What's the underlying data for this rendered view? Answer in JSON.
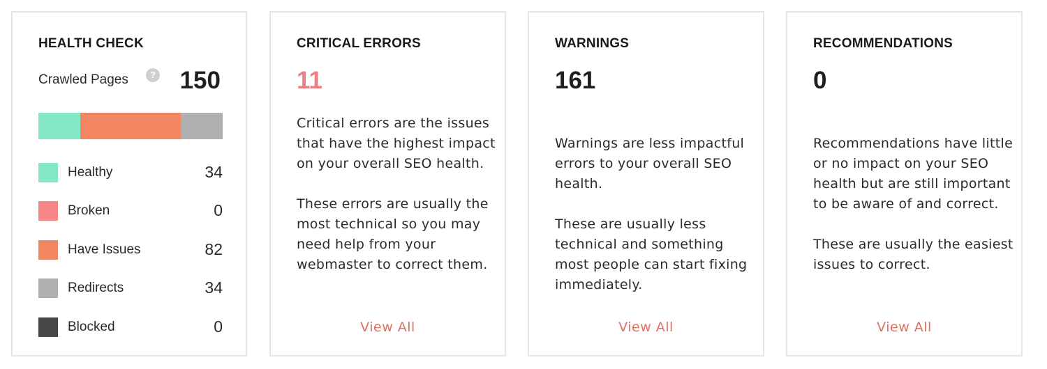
{
  "health_check": {
    "title": "HEALTH CHECK",
    "crawled_label": "Crawled Pages",
    "help_icon": "?",
    "crawled_value": "150",
    "items": [
      {
        "label": "Healthy",
        "value": "34",
        "color": "#84e8c4"
      },
      {
        "label": "Broken",
        "value": "0",
        "color": "#f78787"
      },
      {
        "label": "Have Issues",
        "value": "82",
        "color": "#f28663"
      },
      {
        "label": "Redirects",
        "value": "34",
        "color": "#b0b0b3"
      },
      {
        "label": "Blocked",
        "value": "0",
        "color": "#474747"
      }
    ],
    "bar_fractions": {
      "healthy": 0.2267,
      "broken": 0,
      "have_issues": 0.5467,
      "redirects": 0.2267,
      "blocked": 0
    }
  },
  "critical": {
    "title": "CRITICAL ERRORS",
    "value": "11",
    "para1": "Critical errors are the issues that have the highest impact on your overall SEO health.",
    "para2": "These errors are usually the most technical so you may need help from your webmaster to correct them.",
    "link": "View All"
  },
  "warnings": {
    "title": "WARNINGS",
    "value": "161",
    "para1": "Warnings are less impactful errors to your overall SEO health.",
    "para2": "These are usually less technical and something most people can start fixing immediately.",
    "link": "View All"
  },
  "recommendations": {
    "title": "RECOMMENDATIONS",
    "value": "0",
    "para1": "Recommendations have little or no impact on your SEO health but are still important to be aware of and correct.",
    "para2": "These are usually the easiest issues to correct.",
    "link": "View All"
  },
  "colors": {
    "accent_link": "#e07060",
    "critical_number": "#f08080",
    "border": "#e6e6e6"
  }
}
